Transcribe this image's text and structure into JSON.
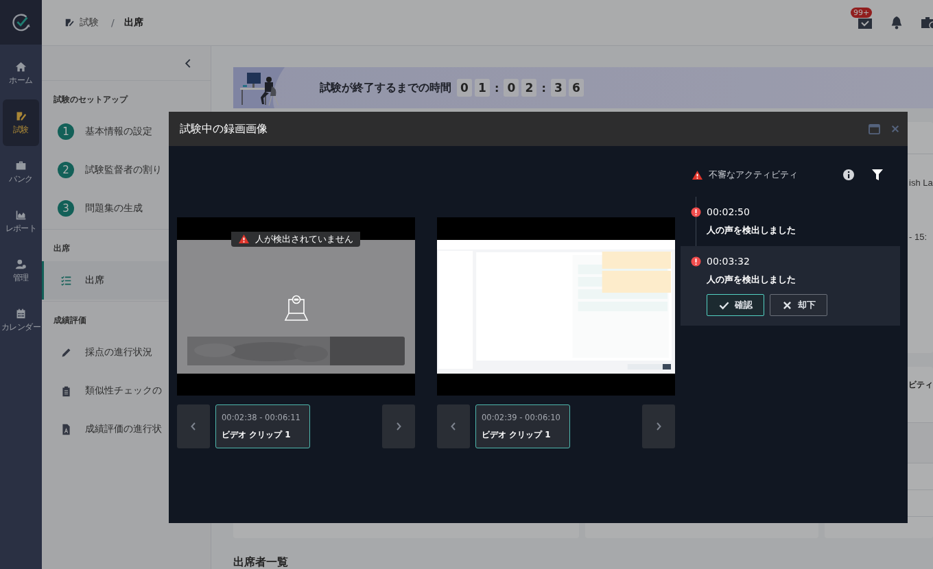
{
  "rail": {
    "items": [
      {
        "label": "ホーム",
        "selected": false
      },
      {
        "label": "試験",
        "selected": true
      },
      {
        "label": "バンク",
        "selected": false
      },
      {
        "label": "レポート",
        "selected": false
      },
      {
        "label": "管理",
        "selected": false
      },
      {
        "label": "カレンダー",
        "selected": false
      }
    ]
  },
  "breadcrumb": {
    "items": [
      {
        "label": "試験",
        "current": false
      },
      {
        "label": "出席",
        "current": true
      }
    ],
    "separator": "/"
  },
  "header": {
    "mail_badge": "99+"
  },
  "sidebar": {
    "sections": [
      {
        "title": "試験のセットアップ",
        "items": [
          {
            "kind": "step",
            "number": "1",
            "label": "基本情報の設定",
            "selected": false
          },
          {
            "kind": "step",
            "number": "2",
            "label": "試験監督者の割り",
            "selected": false
          },
          {
            "kind": "step",
            "number": "3",
            "label": "問題集の生成",
            "selected": false
          }
        ]
      },
      {
        "title": "出席",
        "items": [
          {
            "kind": "icon",
            "label": "出席",
            "selected": true
          }
        ]
      },
      {
        "title": "成績評価",
        "items": [
          {
            "kind": "icon",
            "label": "採点の進行状況",
            "selected": false
          },
          {
            "kind": "icon",
            "label": "類似性チェックの",
            "selected": false
          },
          {
            "kind": "icon",
            "label": "成績評価の進行状",
            "selected": false
          }
        ]
      }
    ]
  },
  "banner": {
    "text": "試験が終了するまでの時間",
    "timer": [
      {
        "kind": "digit",
        "text": "0"
      },
      {
        "kind": "digit",
        "text": "1"
      },
      {
        "kind": "separator",
        "text": ":"
      },
      {
        "kind": "digit",
        "text": "0"
      },
      {
        "kind": "digit",
        "text": "2"
      },
      {
        "kind": "separator",
        "text": ":"
      },
      {
        "kind": "digit",
        "text": "3"
      },
      {
        "kind": "digit",
        "text": "6"
      }
    ]
  },
  "background_cards": {
    "texts": [
      "ish La",
      "- 15:"
    ],
    "section_heading": "ビティ"
  },
  "attendee_list": {
    "title": "出席者一覧"
  },
  "modal": {
    "title": "試験中の録画画像",
    "videos": [
      {
        "kind": "camera",
        "warning": "人が検出されていません",
        "clips": [
          {
            "range": "00:02:38 - 00:06:11",
            "label": "ビデオ クリップ 1",
            "selected": true
          }
        ]
      },
      {
        "kind": "screen",
        "clips": [
          {
            "range": "00:02:39 - 00:06:10",
            "label": "ビデオ クリップ 1",
            "selected": true
          }
        ]
      }
    ],
    "activity": {
      "title": "不審なアクティビティ",
      "items": [
        {
          "time": "00:02:50",
          "message": "人の声を検出しました",
          "selected": false
        },
        {
          "time": "00:03:32",
          "message": "人の声を検出しました",
          "selected": true
        }
      ],
      "actions": [
        {
          "kind": "confirm",
          "label": "確認"
        },
        {
          "kind": "reject",
          "label": "却下"
        }
      ]
    }
  }
}
